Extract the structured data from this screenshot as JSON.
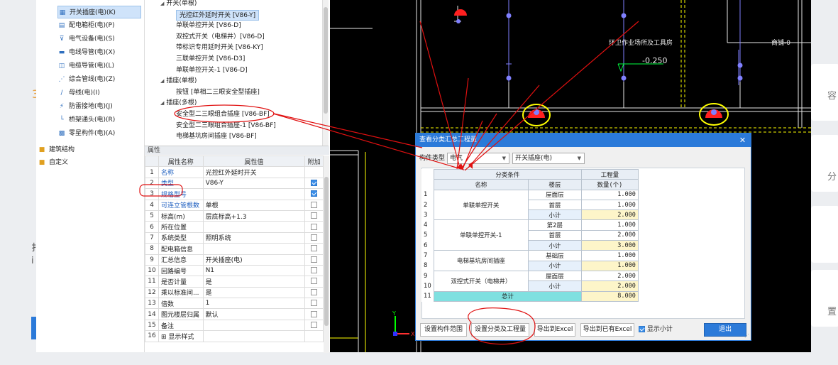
{
  "tree_left": [
    {
      "label": "开关插座(电)(K)",
      "icon": "switch-socket-icon",
      "selected": true
    },
    {
      "label": "配电箱柜(电)(P)",
      "icon": "distribution-box-icon"
    },
    {
      "label": "电气设备(电)(S)",
      "icon": "electrical-equipment-icon"
    },
    {
      "label": "电线导管(电)(X)",
      "icon": "wire-conduit-icon"
    },
    {
      "label": "电缆导管(电)(L)",
      "icon": "cable-conduit-icon"
    },
    {
      "label": "综合管线(电)(Z)",
      "icon": "combined-pipeline-icon"
    },
    {
      "label": "母线(电)(I)",
      "icon": "busbar-icon"
    },
    {
      "label": "防雷接地(电)(J)",
      "icon": "lightning-ground-icon"
    },
    {
      "label": "桥架通头(电)(R)",
      "icon": "bridge-fitting-icon"
    },
    {
      "label": "零星构件(电)(A)",
      "icon": "misc-component-icon"
    },
    {
      "label": "建筑结构",
      "icon": "folder-icon",
      "folder": true
    },
    {
      "label": "自定义",
      "icon": "folder-icon",
      "folder": true
    }
  ],
  "tree_right": [
    {
      "label": "开关(单根)",
      "level": 0
    },
    {
      "label": "光控红外延时开关 [V86-Y]",
      "level": 1,
      "selected": true
    },
    {
      "label": "单联单控开关 [V86-D]",
      "level": 1
    },
    {
      "label": "双控式开关（电梯井）[V86-D]",
      "level": 1
    },
    {
      "label": "带标识专用延时开关 [V86-KY]",
      "level": 1
    },
    {
      "label": "三联单控开关 [V86-D3]",
      "level": 1
    },
    {
      "label": "单联单控开关-1 [V86-D]",
      "level": 1
    },
    {
      "label": "插座(单根)",
      "level": 0
    },
    {
      "label": "按钮 [单相二三眼安全型插座]",
      "level": 1
    },
    {
      "label": "插座(多根)",
      "level": 0
    },
    {
      "label": "安全型二三眼组合插座 [V86-BF]",
      "level": 1
    },
    {
      "label": "安全型二三眼组合插座-1 [V86-BF]",
      "level": 1
    },
    {
      "label": "电梯基坑房间插座 [V86-BF]",
      "level": 1
    }
  ],
  "props": {
    "panel_title": "属性",
    "col_name": "属性名称",
    "col_value": "属性值",
    "col_add": "附加",
    "rows": [
      {
        "n": "1",
        "name": "名称",
        "value": "光控红外延时开关",
        "blue": true,
        "check": "none"
      },
      {
        "n": "2",
        "name": "类型",
        "value": "V86-Y",
        "blue": true,
        "check": "on"
      },
      {
        "n": "3",
        "name": "规格型号",
        "value": "",
        "blue": true,
        "check": "on"
      },
      {
        "n": "4",
        "name": "可连立管根数",
        "value": "单根",
        "blue": true,
        "check": "off"
      },
      {
        "n": "5",
        "name": "标高(m)",
        "value": "层底标高+1.3",
        "blue": false,
        "check": "off"
      },
      {
        "n": "6",
        "name": "所在位置",
        "value": "",
        "blue": false,
        "check": "off"
      },
      {
        "n": "7",
        "name": "系统类型",
        "value": "照明系统",
        "blue": false,
        "check": "off"
      },
      {
        "n": "8",
        "name": "配电箱信息",
        "value": "",
        "blue": false,
        "check": "off"
      },
      {
        "n": "9",
        "name": "汇总信息",
        "value": "开关插座(电)",
        "blue": false,
        "check": "off"
      },
      {
        "n": "10",
        "name": "回路编号",
        "value": "N1",
        "blue": false,
        "check": "off"
      },
      {
        "n": "11",
        "name": "是否计量",
        "value": "是",
        "blue": false,
        "check": "off"
      },
      {
        "n": "12",
        "name": "乘以标准间...",
        "value": "是",
        "blue": false,
        "check": "off"
      },
      {
        "n": "13",
        "name": "倍数",
        "value": "1",
        "blue": false,
        "check": "off"
      },
      {
        "n": "14",
        "name": "图元楼层归属",
        "value": "默认",
        "blue": false,
        "check": "off"
      },
      {
        "n": "15",
        "name": "备注",
        "value": "",
        "blue": false,
        "check": "off"
      },
      {
        "n": "16",
        "name": "⊞ 显示样式",
        "value": "",
        "blue": false,
        "check": "none"
      }
    ]
  },
  "cad": {
    "text_room": "环卫作业场所及工具房",
    "text_elev": "-0.250",
    "text_right": "商铺-0",
    "axis_y": "Y",
    "axis_x": "X"
  },
  "dialog": {
    "title": "查看分类汇总工程量",
    "component_type_label": "构件类型",
    "component_type_value": "电气",
    "subtype_value": "开关插座(电)",
    "hdr_condition": "分类条件",
    "hdr_quantity": "工程量",
    "hdr_name": "名称",
    "hdr_floor": "楼层",
    "hdr_count": "数量(个)",
    "groups": [
      {
        "name": "单联单控开关",
        "rows": [
          {
            "n": "1",
            "floor": "屋面层",
            "qty": "1.000"
          },
          {
            "n": "2",
            "floor": "首层",
            "qty": "1.000"
          },
          {
            "n": "3",
            "floor": "小计",
            "qty": "2.000",
            "sub": true
          }
        ]
      },
      {
        "name": "单联单控开关-1",
        "rows": [
          {
            "n": "4",
            "floor": "第2层",
            "qty": "1.000"
          },
          {
            "n": "5",
            "floor": "首层",
            "qty": "2.000"
          },
          {
            "n": "6",
            "floor": "小计",
            "qty": "3.000",
            "sub": true
          }
        ]
      },
      {
        "name": "电梯基坑房间插座",
        "rows": [
          {
            "n": "7",
            "floor": "基础层",
            "qty": "1.000"
          },
          {
            "n": "8",
            "floor": "小计",
            "qty": "1.000",
            "sub": true
          }
        ]
      },
      {
        "name": "双控式开关（电梯井）",
        "rows": [
          {
            "n": "9",
            "floor": "屋面层",
            "qty": "2.000"
          },
          {
            "n": "10",
            "floor": "小计",
            "qty": "2.000",
            "sub": true
          }
        ]
      }
    ],
    "total_n": "11",
    "total_label": "总计",
    "total_qty": "8.000",
    "btn_range": "设置构件范围",
    "btn_set_qty": "设置分类及工程量",
    "btn_export": "导出到Excel",
    "btn_export_existing": "导出到已有Excel",
    "show_subtotal": "显示小计",
    "show_subtotal_checked": true,
    "btn_exit": "退出"
  },
  "bg": {
    "char1": "3",
    "char2": "扌",
    "char3": "i",
    "char_right1": "容",
    "char_right2": "分",
    "char_right3": "置"
  },
  "colors": {
    "accent": "#2b7ad9",
    "annotation": "#e01010",
    "cad_line": "#e8e8e8",
    "cad_yellow": "#ffff00",
    "cad_red": "#ff2020"
  }
}
